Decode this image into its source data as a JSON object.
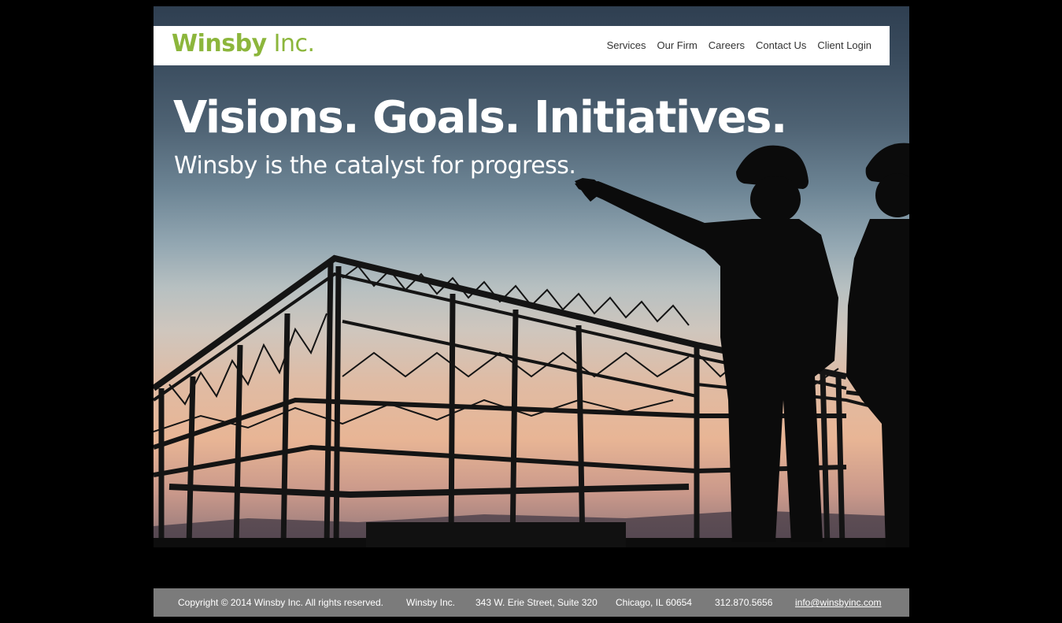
{
  "header": {
    "logo_bold": "Winsby",
    "logo_light": " Inc.",
    "nav": [
      "Services",
      "Our Firm",
      "Careers",
      "Contact Us",
      "Client Login"
    ]
  },
  "hero": {
    "headline": "Visions. Goals. Initiatives.",
    "subhead": "Winsby is the catalyst for progress."
  },
  "footer": {
    "copyright": "Copyright © 2014 Winsby Inc. All rights reserved.",
    "company": "Winsby Inc.",
    "address": "343 W. Erie Street, Suite 320",
    "city": "Chicago, IL 60654",
    "phone": "312.870.5656",
    "email": "info@winsbyinc.com"
  },
  "colors": {
    "brand_green": "#8cb63c",
    "footer_bg": "#7b7b7b"
  }
}
